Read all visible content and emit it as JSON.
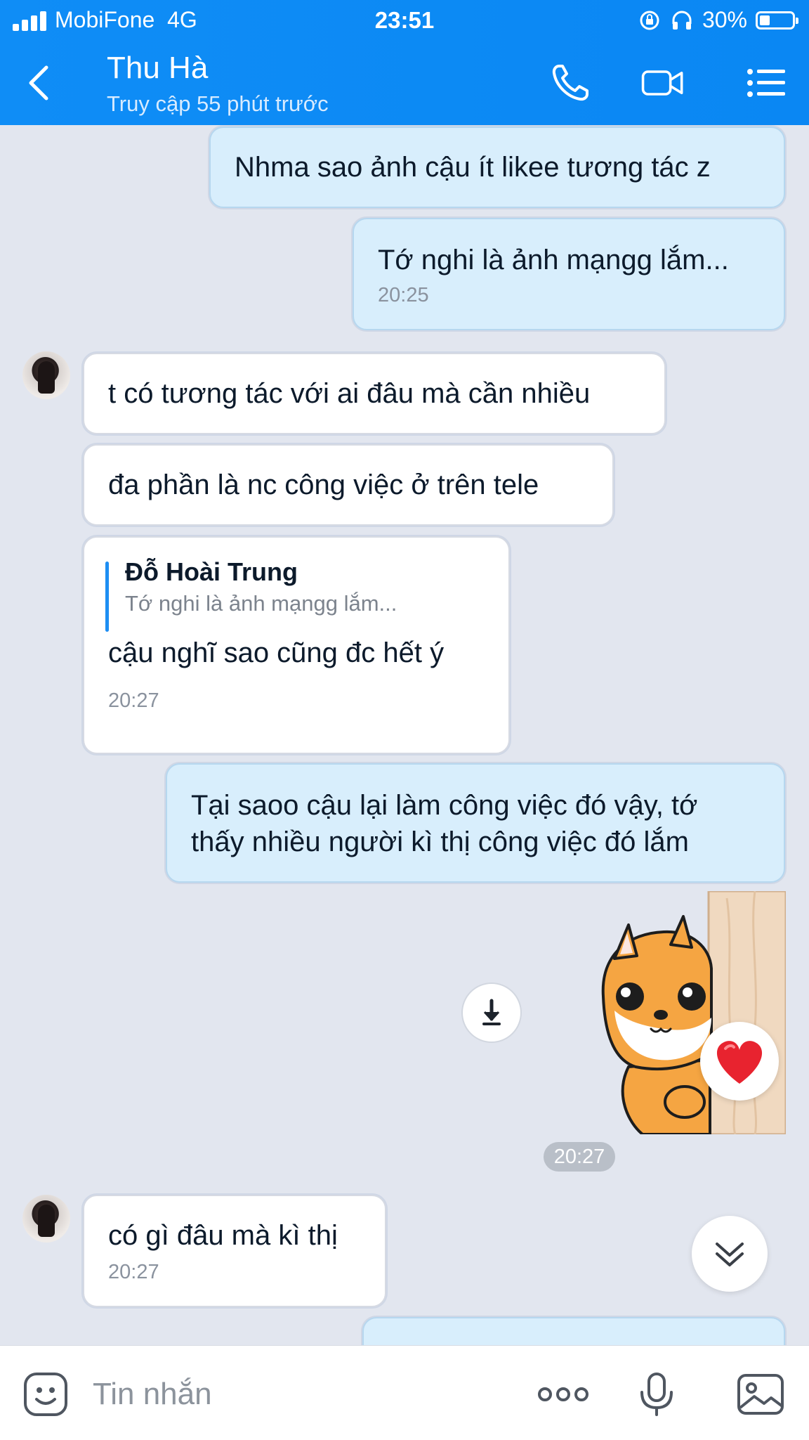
{
  "status_bar": {
    "carrier": "MobiFone",
    "network": "4G",
    "time": "23:51",
    "battery": "30%"
  },
  "header": {
    "contact_name": "Thu Hà",
    "contact_status": "Truy cập 55 phút trước",
    "icons": [
      "back-icon",
      "phone-icon",
      "video-call-icon",
      "menu-list-icon"
    ],
    "background_color": "#0f8df6"
  },
  "messages": [
    {
      "from": "me",
      "text": "Nhma sao ảnh cậu ít likee tương tác z"
    },
    {
      "from": "me",
      "text": "Tớ nghi là ảnh mạngg lắm...",
      "time": "20:25"
    },
    {
      "from": "them",
      "text": "t có tương tác với ai đâu mà cần nhiều"
    },
    {
      "from": "them",
      "text": "đa phần là nc công việc ở trên tele"
    },
    {
      "from": "them",
      "quote_author": "Đỗ Hoài Trung",
      "quote_text": "Tớ nghi là ảnh mạngg lắm...",
      "text": "cậu nghĩ sao cũng đc hết ý",
      "time": "20:27"
    },
    {
      "from": "me",
      "line1": "Tại saoo cậu lại làm công việc đó vậy, tớ",
      "line2": "thấy nhiều người kì thị công việc đó lắm"
    },
    {
      "from": "me",
      "type": "sticker",
      "sticker": "shiba-dog-peeking-sticker",
      "reaction": "heart-icon"
    },
    {
      "from": "them",
      "text": "có gì đâu mà kì thị",
      "time": "20:27"
    }
  ],
  "sticker_time": "20:27",
  "input_bar": {
    "placeholder": "Tin nhắn",
    "icons": [
      "emoji-icon",
      "more-icon",
      "microphone-icon",
      "image-icon"
    ]
  },
  "colors": {
    "accent": "#0f8df6",
    "my_bubble": "#d8eefc",
    "their_bubble": "#ffffff",
    "chat_background": "#e2e6ef"
  }
}
